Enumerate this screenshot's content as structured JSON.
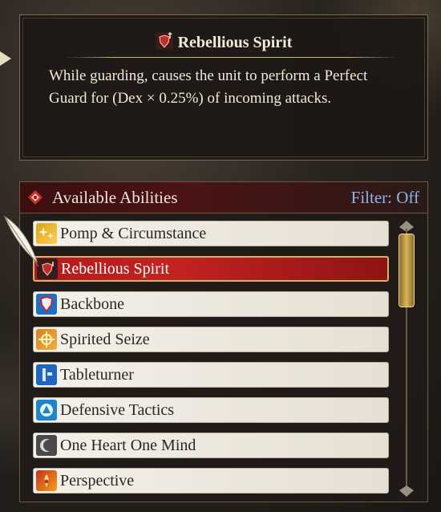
{
  "tooltip": {
    "title": "Rebellious Spirit",
    "icon": "rebellious-spirit-icon",
    "description": "While guarding, causes the unit to perform a Perfect Guard for (Dex × 0.25%) of incoming attacks."
  },
  "abilities_panel": {
    "title": "Available Abilities",
    "filter_label": "Filter: Off",
    "selected_index": 1,
    "items": [
      {
        "label": "Pomp & Circumstance",
        "icon": "pomp-sparkle-icon"
      },
      {
        "label": "Rebellious Spirit",
        "icon": "rebellious-spirit-icon"
      },
      {
        "label": "Backbone",
        "icon": "shield-icon"
      },
      {
        "label": "Spirited Seize",
        "icon": "seize-burst-icon"
      },
      {
        "label": "Tableturner",
        "icon": "tableturner-icon"
      },
      {
        "label": "Defensive Tactics",
        "icon": "defensive-tactics-icon"
      },
      {
        "label": "One Heart One Mind",
        "icon": "crescent-icon"
      },
      {
        "label": "Perspective",
        "icon": "perspective-icon"
      }
    ]
  },
  "colors": {
    "selected_row": "#c32222",
    "filter_text": "#8fb5e8",
    "header_bg": "#4b1314"
  }
}
